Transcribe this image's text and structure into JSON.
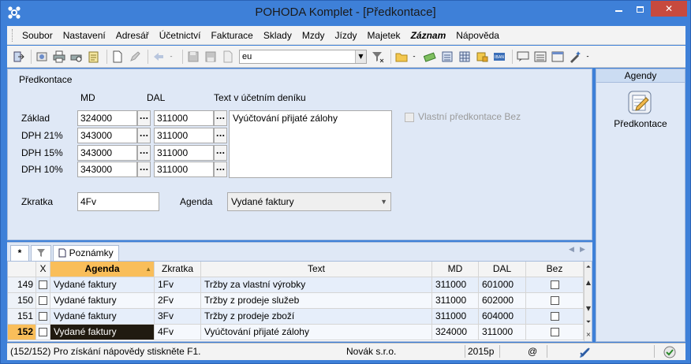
{
  "window": {
    "title": "POHODA Komplet - [Předkontace]"
  },
  "menu": [
    "Soubor",
    "Nastavení",
    "Adresář",
    "Účetnictví",
    "Fakturace",
    "Sklady",
    "Mzdy",
    "Jízdy",
    "Majetek",
    "Záznam",
    "Nápověda"
  ],
  "toolbar": {
    "combo_value": "eu"
  },
  "form": {
    "section_title": "Předkontace",
    "col_md": "MD",
    "col_dal": "DAL",
    "col_text": "Text v účetním deníku",
    "rows": [
      {
        "label": "Základ",
        "md": "324000",
        "dal": "311000"
      },
      {
        "label": "DPH 21%",
        "md": "343000",
        "dal": "311000"
      },
      {
        "label": "DPH 15%",
        "md": "343000",
        "dal": "311000"
      },
      {
        "label": "DPH 10%",
        "md": "343000",
        "dal": "311000"
      }
    ],
    "text_value": "Vyúčtování přijaté zálohy",
    "vlastni_label": "Vlastní předkontace Bez",
    "zkratka_label": "Zkratka",
    "zkratka_value": "4Fv",
    "agenda_label": "Agenda",
    "agenda_value": "Vydané faktury",
    "dots": "..."
  },
  "side": {
    "header": "Agendy",
    "item_label": "Předkontace"
  },
  "tabs": {
    "star": "*",
    "notes": "Poznámky"
  },
  "grid": {
    "columns": [
      "X",
      "Agenda",
      "Zkratka",
      "Text",
      "MD",
      "DAL",
      "Bez"
    ],
    "rows": [
      {
        "num": "149",
        "agenda": "Vydané faktury",
        "zkratka": "1Fv",
        "text": "Tržby za vlastní výrobky",
        "md": "311000",
        "dal": "601000"
      },
      {
        "num": "150",
        "agenda": "Vydané faktury",
        "zkratka": "2Fv",
        "text": "Tržby z prodeje služeb",
        "md": "311000",
        "dal": "602000"
      },
      {
        "num": "151",
        "agenda": "Vydané faktury",
        "zkratka": "3Fv",
        "text": "Tržby z prodeje zboží",
        "md": "311000",
        "dal": "604000"
      },
      {
        "num": "152",
        "agenda": "Vydané faktury",
        "zkratka": "4Fv",
        "text": "Vyúčtování přijaté zálohy",
        "md": "324000",
        "dal": "311000"
      }
    ]
  },
  "status": {
    "help": "(152/152) Pro získání nápovědy stiskněte F1.",
    "company": "Novák s.r.o.",
    "year": "2015p",
    "at": "@"
  }
}
